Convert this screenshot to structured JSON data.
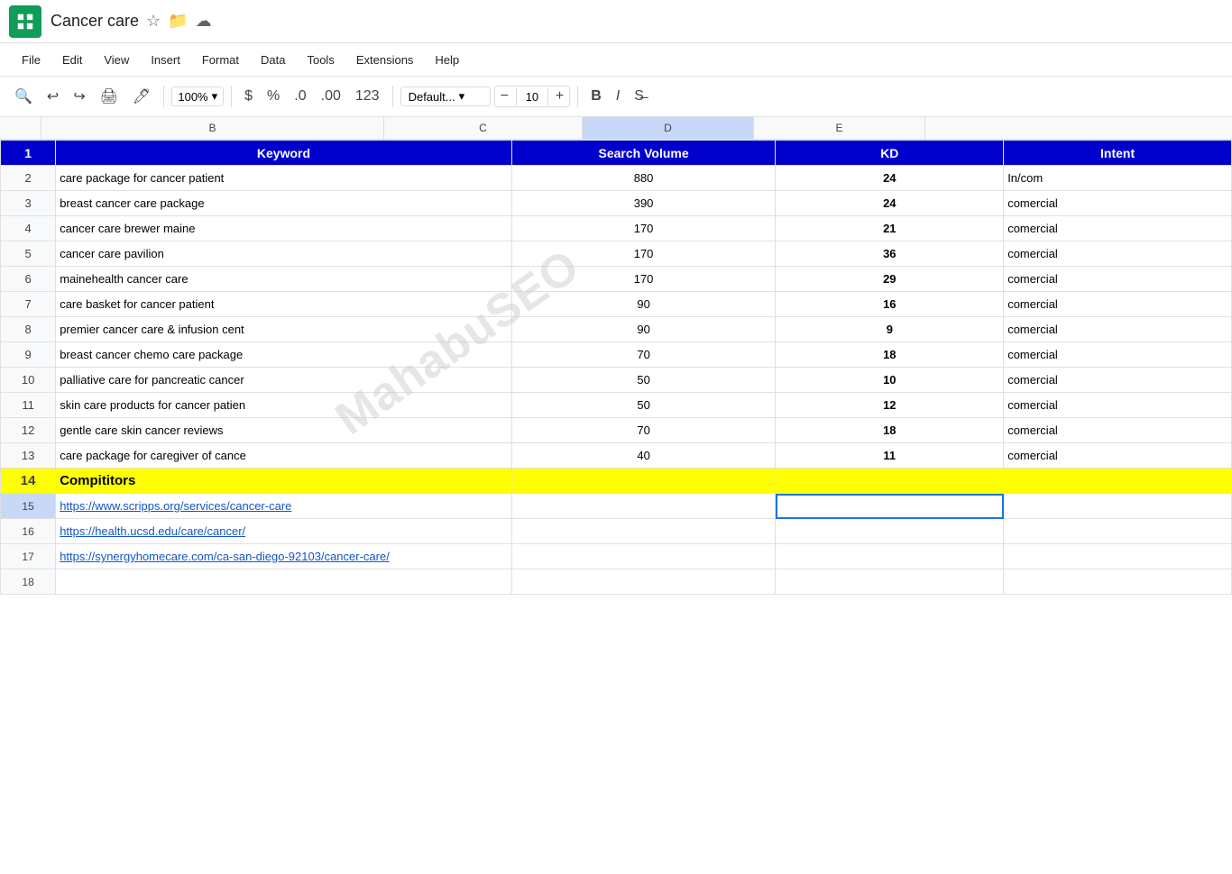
{
  "app": {
    "icon_color": "#0f9d58",
    "title": "Cancer care",
    "menu_items": [
      "File",
      "Edit",
      "View",
      "Insert",
      "Format",
      "Data",
      "Tools",
      "Extensions",
      "Help"
    ]
  },
  "toolbar": {
    "zoom": "100%",
    "font_family": "Default...",
    "font_size": "10",
    "currency_symbol": "$",
    "percent_symbol": "%",
    "format_1": ".0",
    "format_2": ".00",
    "format_3": "123"
  },
  "columns": {
    "b": "B",
    "c": "C",
    "d": "D",
    "e": "E"
  },
  "header_row": {
    "keyword": "Keyword",
    "search_volume": "Search Volume",
    "kd": "KD",
    "intent": "Intent"
  },
  "rows": [
    {
      "num": "2",
      "keyword": "care package for cancer patient",
      "search_volume": "880",
      "kd": "24",
      "intent": "In/com"
    },
    {
      "num": "3",
      "keyword": "breast cancer care package",
      "search_volume": "390",
      "kd": "24",
      "intent": "comercial"
    },
    {
      "num": "4",
      "keyword": "cancer care brewer maine",
      "search_volume": "170",
      "kd": "21",
      "intent": "comercial"
    },
    {
      "num": "5",
      "keyword": "cancer care pavilion",
      "search_volume": "170",
      "kd": "36",
      "intent": "comercial"
    },
    {
      "num": "6",
      "keyword": "mainehealth cancer care",
      "search_volume": "170",
      "kd": "29",
      "intent": "comercial"
    },
    {
      "num": "7",
      "keyword": "care basket for cancer patient",
      "search_volume": "90",
      "kd": "16",
      "intent": "comercial"
    },
    {
      "num": "8",
      "keyword": "premier cancer care & infusion cent",
      "search_volume": "90",
      "kd": "9",
      "intent": "comercial"
    },
    {
      "num": "9",
      "keyword": "breast cancer chemo care package",
      "search_volume": "70",
      "kd": "18",
      "intent": "comercial"
    },
    {
      "num": "10",
      "keyword": "palliative care for pancreatic cancer",
      "search_volume": "50",
      "kd": "10",
      "intent": "comercial"
    },
    {
      "num": "11",
      "keyword": "skin care products for cancer patien",
      "search_volume": "50",
      "kd": "12",
      "intent": "comercial"
    },
    {
      "num": "12",
      "keyword": "gentle care skin cancer reviews",
      "search_volume": "70",
      "kd": "18",
      "intent": "comercial"
    },
    {
      "num": "13",
      "keyword": "care package for caregiver of cance",
      "search_volume": "40",
      "kd": "11",
      "intent": "comercial"
    }
  ],
  "competitors_row": {
    "num": "14",
    "label": "Compititors"
  },
  "link_rows": [
    {
      "num": "15",
      "url": "https://www.scripps.org/services/cancer-care"
    },
    {
      "num": "16",
      "url": "https://health.ucsd.edu/care/cancer/"
    },
    {
      "num": "17",
      "url": "https://synergyhomecare.com/ca-san-diego-92103/cancer-care/"
    }
  ],
  "empty_row": {
    "num": "18"
  },
  "watermark": "MahabuSEO",
  "selected_cell": "D15"
}
